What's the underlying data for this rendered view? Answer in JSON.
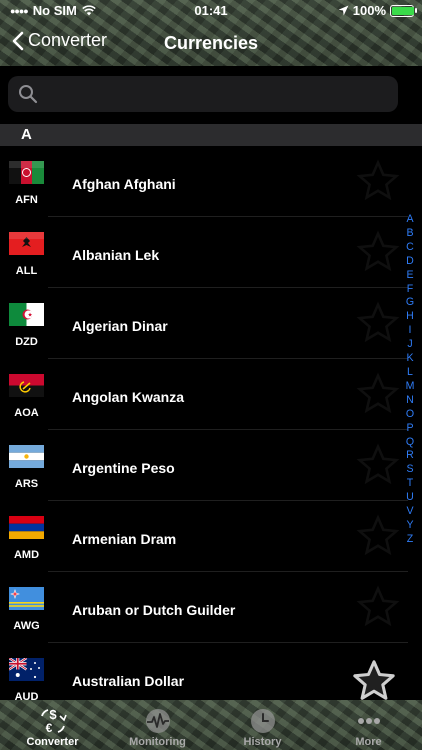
{
  "status": {
    "carrier": "No SIM",
    "time": "01:41",
    "battery": "100%",
    "battery_level": 1.0
  },
  "nav": {
    "back_label": "Converter",
    "title": "Currencies"
  },
  "search": {
    "placeholder": ""
  },
  "section": {
    "letter": "A"
  },
  "currencies": [
    {
      "code": "AFN",
      "name": "Afghan Afghani"
    },
    {
      "code": "ALL",
      "name": "Albanian Lek"
    },
    {
      "code": "DZD",
      "name": "Algerian Dinar"
    },
    {
      "code": "AOA",
      "name": "Angolan Kwanza"
    },
    {
      "code": "ARS",
      "name": "Argentine Peso"
    },
    {
      "code": "AMD",
      "name": "Armenian Dram"
    },
    {
      "code": "AWG",
      "name": "Aruban or Dutch Guilder"
    },
    {
      "code": "AUD",
      "name": "Australian Dollar"
    }
  ],
  "alphabet": [
    "A",
    "B",
    "C",
    "D",
    "E",
    "F",
    "G",
    "H",
    "I",
    "J",
    "K",
    "L",
    "M",
    "N",
    "O",
    "P",
    "Q",
    "R",
    "S",
    "T",
    "U",
    "V",
    "Y",
    "Z"
  ],
  "tabs": [
    {
      "label": "Converter",
      "icon": "converter-icon"
    },
    {
      "label": "Monitoring",
      "icon": "monitoring-icon"
    },
    {
      "label": "History",
      "icon": "history-icon"
    },
    {
      "label": "More",
      "icon": "more-icon"
    }
  ],
  "colors": {
    "accent": "#2f7cf6",
    "battery": "#3adb4a",
    "section": "#2c2c2e",
    "search_bg": "#1c1c1e"
  }
}
